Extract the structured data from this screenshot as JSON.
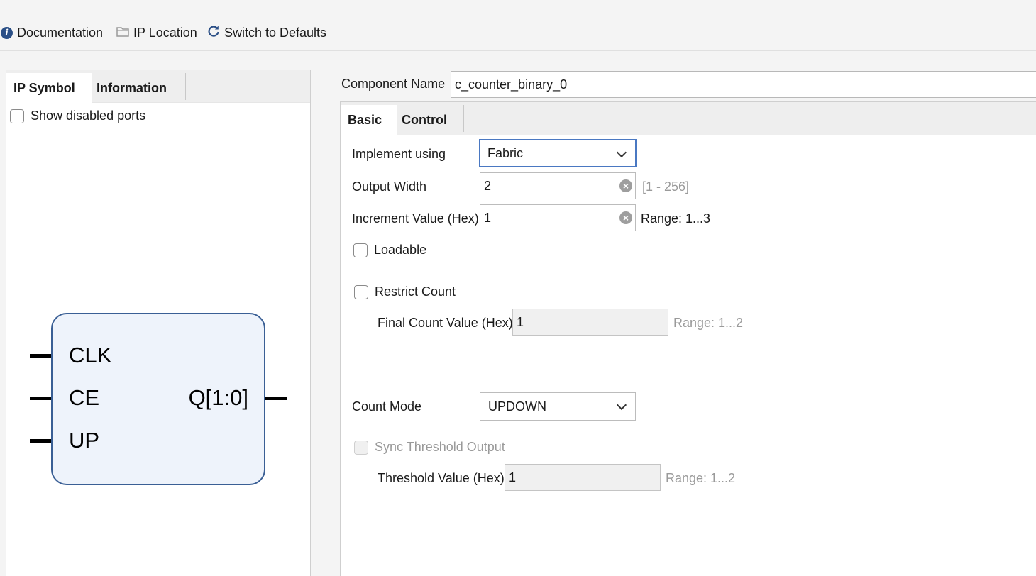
{
  "toolbar": {
    "documentation": "Documentation",
    "ip_location": "IP Location",
    "switch_defaults": "Switch to Defaults"
  },
  "left_panel": {
    "tabs": [
      "IP Symbol",
      "Information"
    ],
    "show_disabled_ports": "Show disabled ports",
    "symbol": {
      "inputs": [
        "CLK",
        "CE",
        "UP"
      ],
      "output": "Q[1:0]"
    }
  },
  "component_name": {
    "label": "Component Name",
    "value": "c_counter_binary_0"
  },
  "right_panel": {
    "tabs": [
      "Basic",
      "Control"
    ],
    "implement_using": {
      "label": "Implement using",
      "value": "Fabric"
    },
    "output_width": {
      "label": "Output Width",
      "value": "2",
      "hint": "[1 - 256]"
    },
    "increment_value": {
      "label": "Increment Value (Hex)",
      "value": "1",
      "hint": "Range: 1...3"
    },
    "loadable": {
      "label": "Loadable",
      "checked": false
    },
    "restrict_count": {
      "label": "Restrict Count",
      "checked": false
    },
    "final_count": {
      "label": "Final Count Value (Hex)",
      "value": "1",
      "hint": "Range: 1...2"
    },
    "count_mode": {
      "label": "Count Mode",
      "value": "UPDOWN"
    },
    "sync_threshold": {
      "label": "Sync Threshold Output",
      "checked": false
    },
    "threshold_value": {
      "label": "Threshold Value (Hex)",
      "value": "1",
      "hint": "Range: 1...2"
    }
  },
  "colors": {
    "symbol_fill": "#eef3fb",
    "symbol_border": "#3a5f95",
    "focus_border": "#4a78c2"
  }
}
